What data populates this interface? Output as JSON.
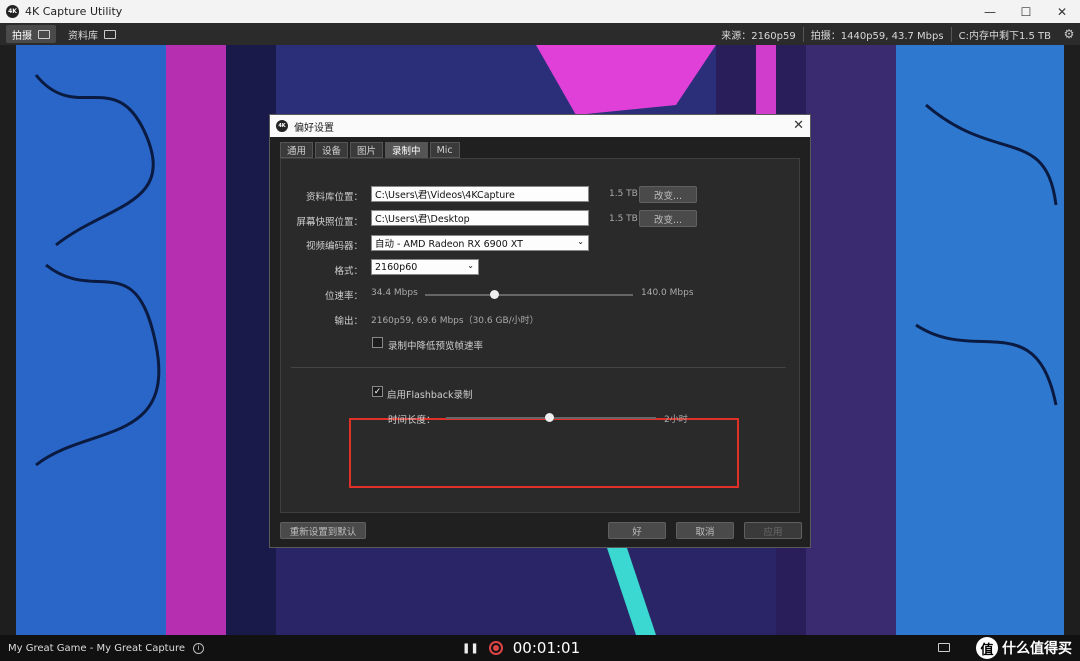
{
  "app": {
    "title": "4K Capture Utility",
    "logo": "4K"
  },
  "window_controls": {
    "minimize": "—",
    "maximize": "☐",
    "close": "✕"
  },
  "toolbar": {
    "tabs": [
      {
        "label": "拍摄"
      },
      {
        "label": "资料库"
      }
    ],
    "status": {
      "source": "来源：2160p59",
      "capture": "拍摄：1440p59, 43.7 Mbps",
      "storage": "C:内存中剩下1.5 TB"
    },
    "settings_icon": "⚙"
  },
  "dialog": {
    "title": "偏好设置",
    "tabs": [
      "通用",
      "设备",
      "图片",
      "录制中",
      "Mic"
    ],
    "active_tab": "录制中",
    "library_location": {
      "label": "资料库位置：",
      "value": "C:\\Users\\君\\Videos\\4KCapture",
      "size": "1.5 TB",
      "button": "改变..."
    },
    "snapshot_location": {
      "label": "屏幕快照位置：",
      "value": "C:\\Users\\君\\Desktop",
      "size": "1.5 TB",
      "button": "改变..."
    },
    "encoder": {
      "label": "视频编码器：",
      "value": "自动 - AMD Radeon RX 6900 XT"
    },
    "format": {
      "label": "格式：",
      "value": "2160p60"
    },
    "bitrate": {
      "label": "位速率：",
      "min": "34.4 Mbps",
      "max": "140.0 Mbps",
      "level": 0.33
    },
    "output": {
      "label": "输出：",
      "value": "2160p59, 69.6 Mbps（30.6 GB/小时）"
    },
    "reduce_preview": {
      "label": "录制中降低预览帧速率",
      "checked": false
    },
    "flashback": {
      "label": "启用Flashback录制",
      "checked": true
    },
    "duration": {
      "label": "时间长度：",
      "value": "2小时",
      "level": 0.49
    },
    "buttons": {
      "reset": "重新设置到默认",
      "ok": "好",
      "cancel": "取消",
      "apply": "应用"
    }
  },
  "bottombar": {
    "capture_name": "My Great Game - My Great Capture",
    "info_icon": "i",
    "pause_icon": "❚❚",
    "timer": "00:01:01",
    "watermark": "什么值得买",
    "watermark_logo": "值"
  }
}
